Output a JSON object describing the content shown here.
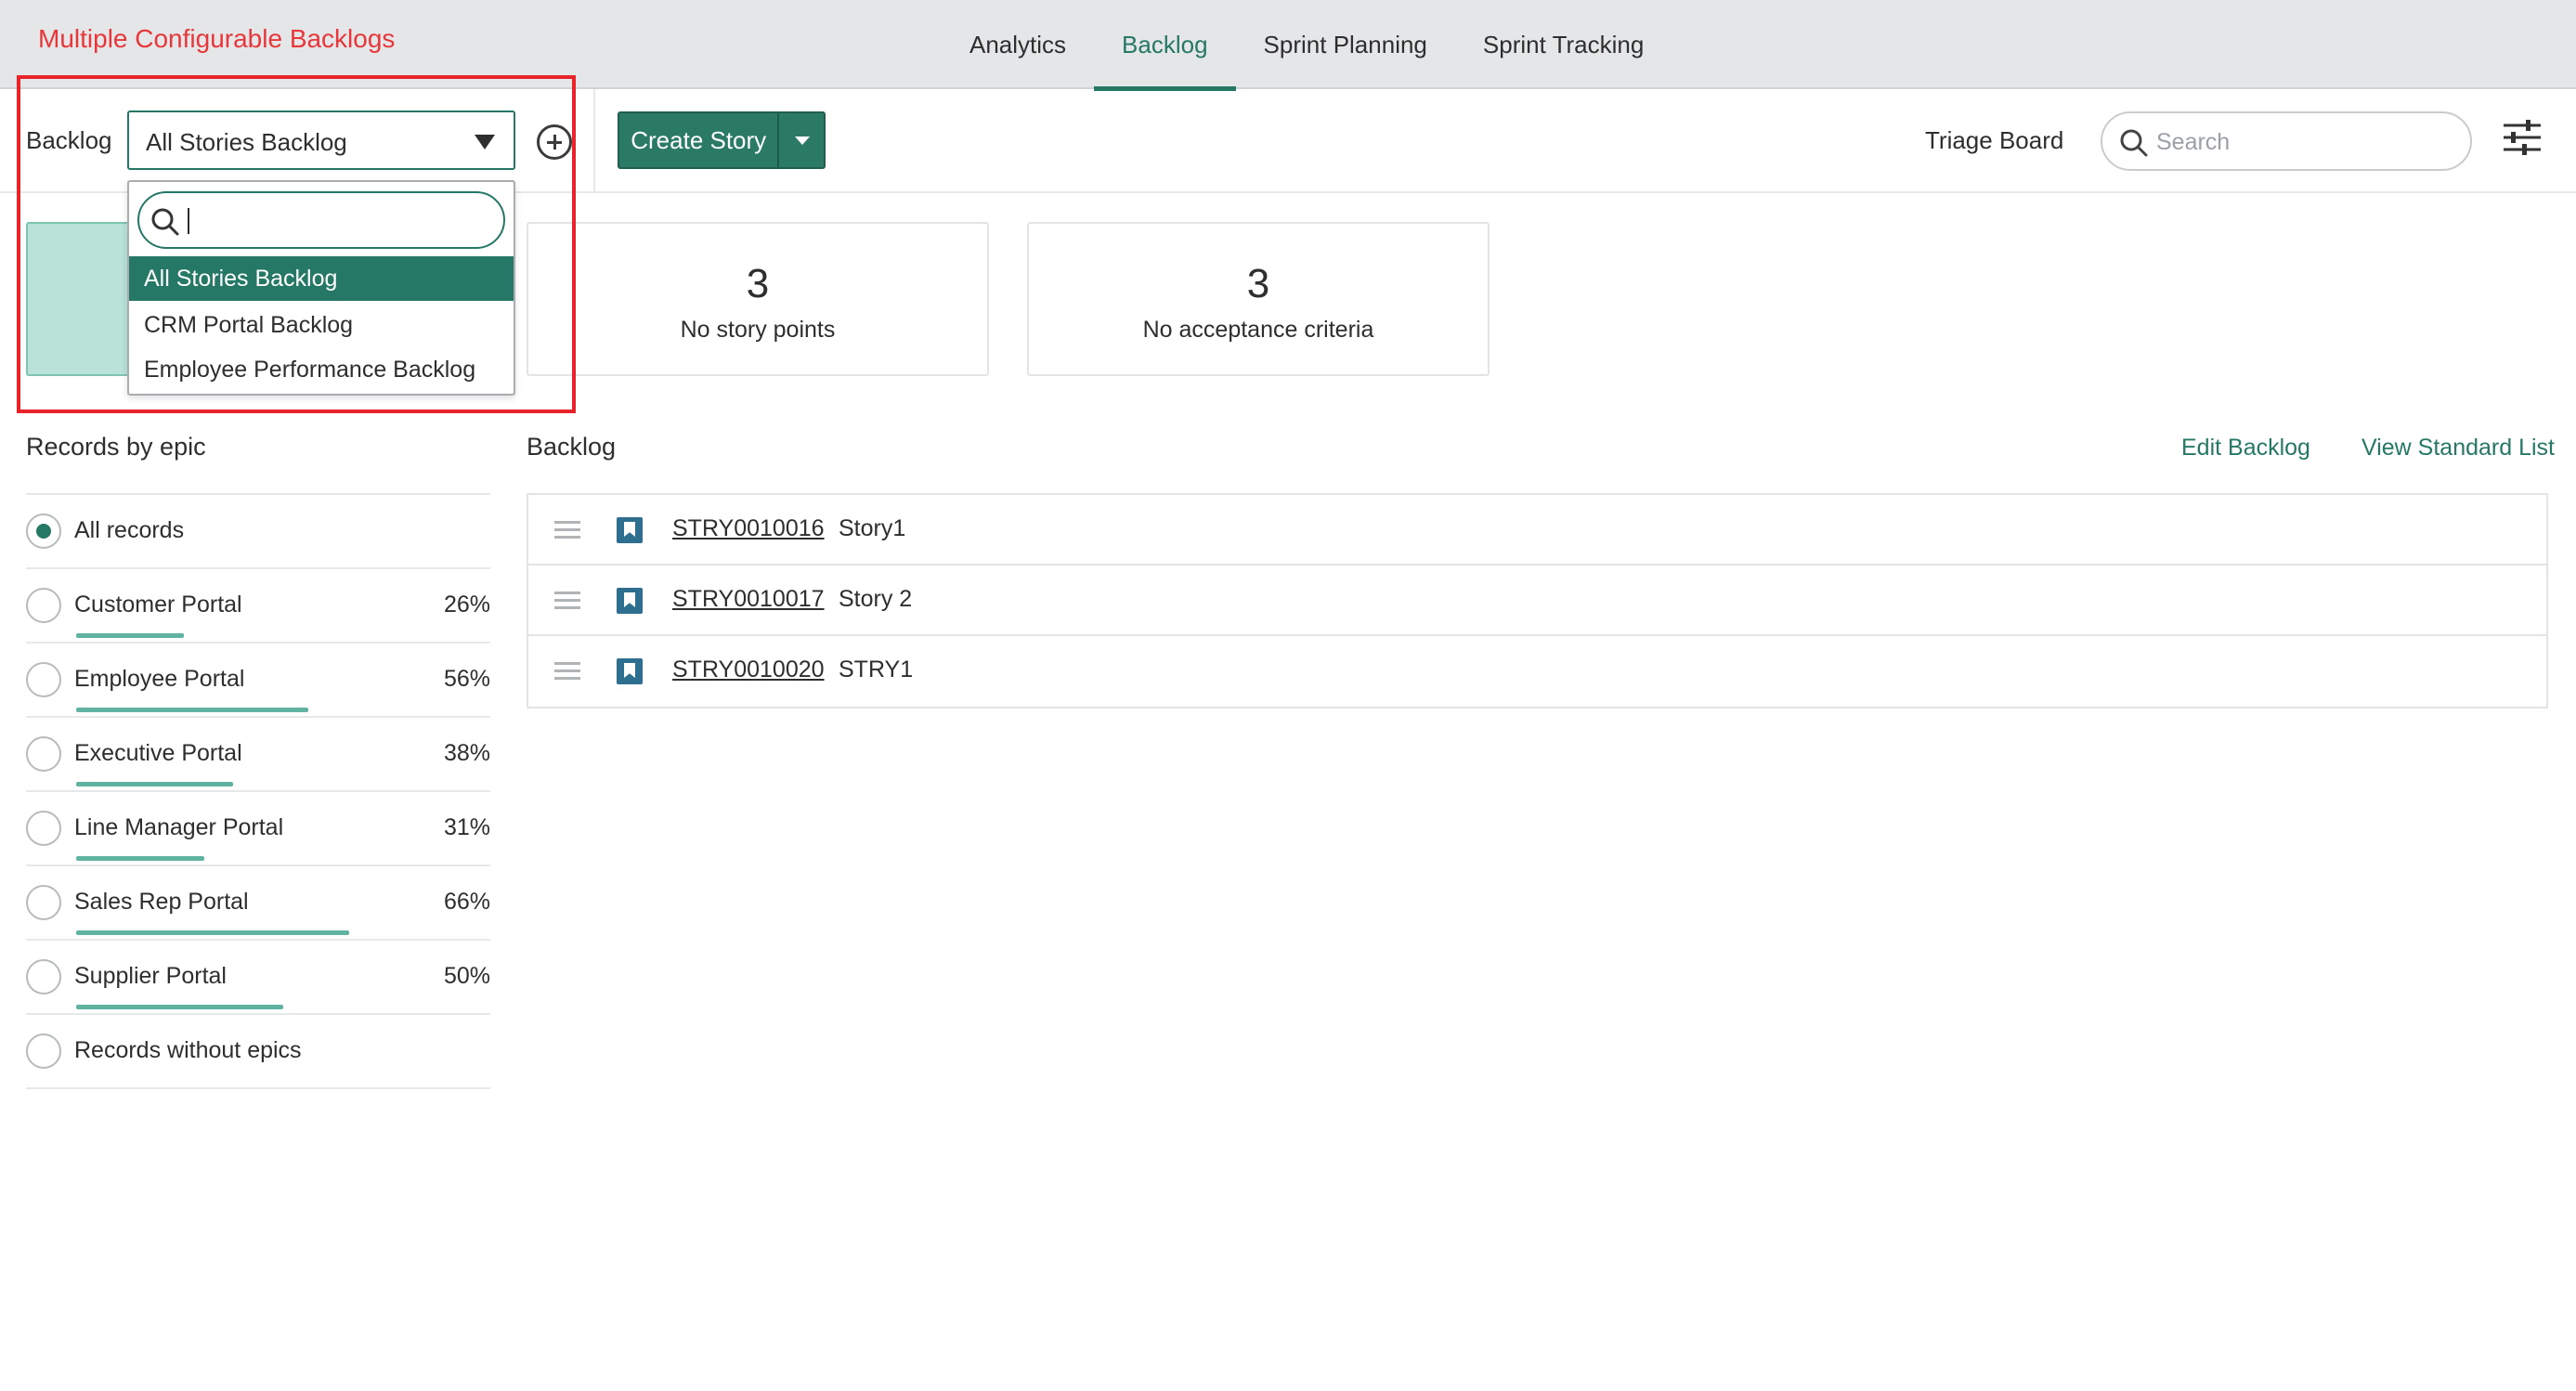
{
  "annotation": {
    "title": "Multiple Configurable Backlogs"
  },
  "tabs": [
    {
      "label": "Analytics"
    },
    {
      "label": "Backlog",
      "active": true
    },
    {
      "label": "Sprint Planning"
    },
    {
      "label": "Sprint Tracking"
    }
  ],
  "toolbar": {
    "backlog_label": "Backlog",
    "backlog_selected": "All Stories Backlog",
    "create_story_label": "Create Story",
    "triage_label": "Triage Board",
    "search_placeholder": "Search"
  },
  "dropdown": {
    "options": [
      {
        "label": "All Stories Backlog",
        "selected": true
      },
      {
        "label": "CRM Portal Backlog"
      },
      {
        "label": "Employee Performance Backlog"
      }
    ]
  },
  "cards": [
    {
      "value": "3",
      "label": "No story points"
    },
    {
      "value": "3",
      "label": "No acceptance criteria"
    }
  ],
  "epics": {
    "title": "Records by epic",
    "items": [
      {
        "name": "All records",
        "selected": true
      },
      {
        "name": "Customer Portal",
        "percent": "26%",
        "progress": 0.26
      },
      {
        "name": "Employee Portal",
        "percent": "56%",
        "progress": 0.56
      },
      {
        "name": "Executive Portal",
        "percent": "38%",
        "progress": 0.38
      },
      {
        "name": "Line Manager Portal",
        "percent": "31%",
        "progress": 0.31
      },
      {
        "name": "Sales Rep Portal",
        "percent": "66%",
        "progress": 0.66
      },
      {
        "name": "Supplier Portal",
        "percent": "50%",
        "progress": 0.5
      },
      {
        "name": "Records without epics"
      }
    ]
  },
  "backlog": {
    "title": "Backlog",
    "edit_link": "Edit Backlog",
    "view_link": "View Standard List",
    "stories": [
      {
        "number": "STRY0010016",
        "title": "Story1"
      },
      {
        "number": "STRY0010017",
        "title": "Story 2"
      },
      {
        "number": "STRY0010020",
        "title": "STRY1"
      }
    ]
  },
  "colors": {
    "accent": "#267866",
    "annotation": "#e8232a",
    "selected_card": "#b9e2d8",
    "progress": "#5fb3a0"
  }
}
